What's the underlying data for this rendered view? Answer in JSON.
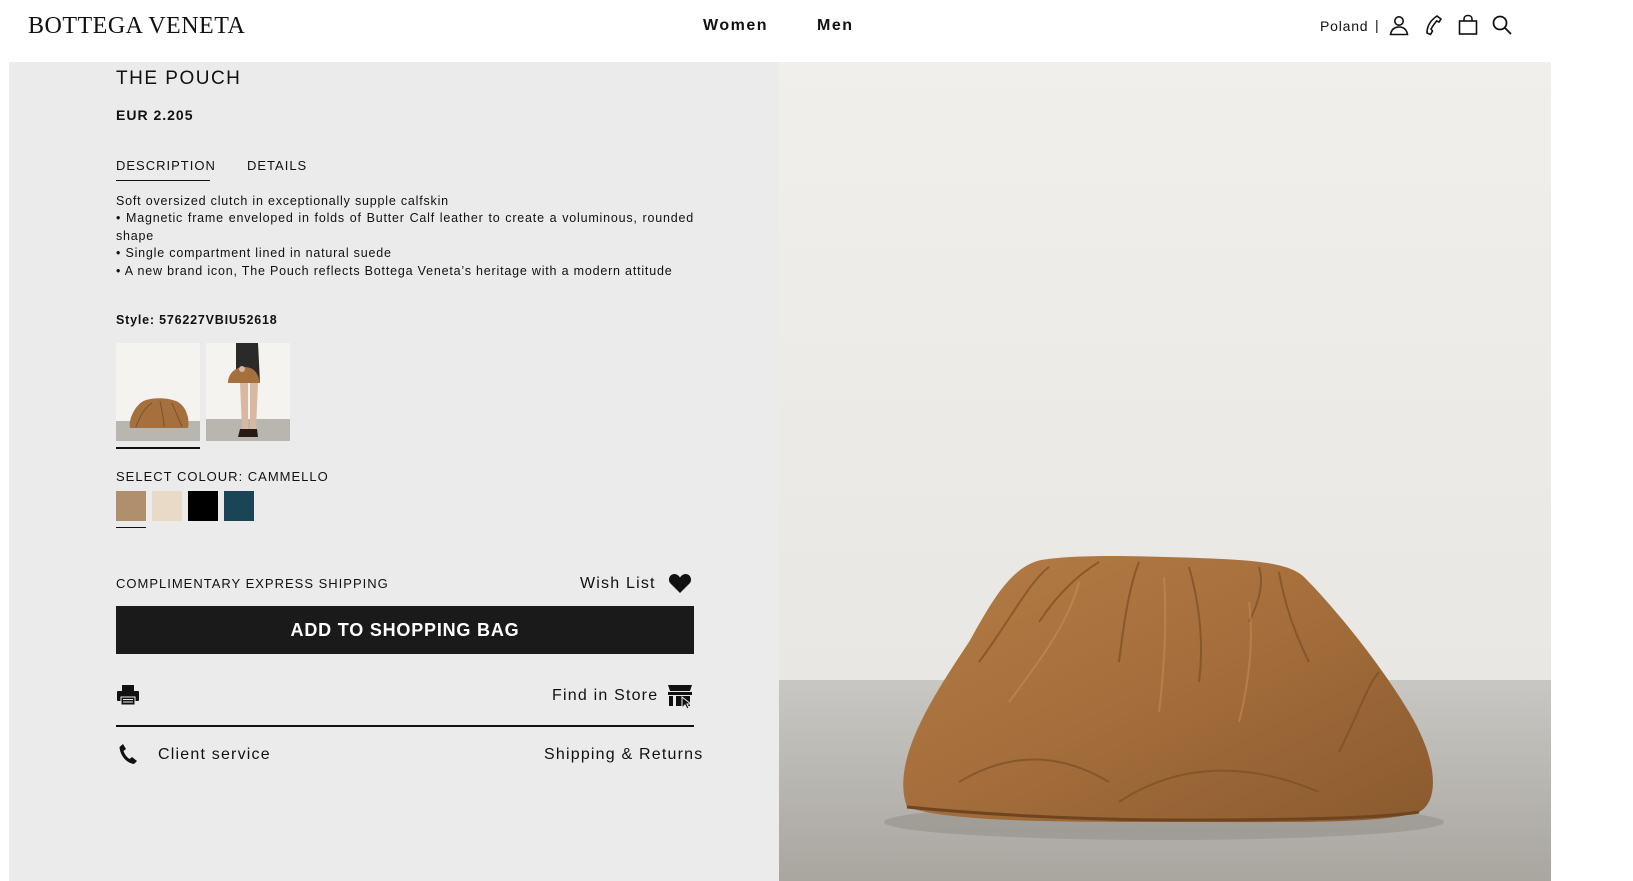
{
  "header": {
    "logo": "BOTTEGA VENETA",
    "nav": [
      "Women",
      "Men"
    ],
    "country": "Poland",
    "separator": "|",
    "icons": [
      "account-icon",
      "phone-icon",
      "shopping-bag-icon",
      "search-icon"
    ]
  },
  "product": {
    "title": "THE POUCH",
    "price": "EUR 2.205",
    "tabs": [
      "DESCRIPTION",
      "DETAILS"
    ],
    "active_tab": "DESCRIPTION",
    "description": [
      "Soft oversized clutch in exceptionally supple calfskin",
      "• Magnetic frame enveloped in folds of Butter Calf leather to create a voluminous, rounded shape",
      "• Single compartment lined in natural suede",
      "• A new brand icon, The Pouch reflects Bottega Veneta’s heritage with a modern attitude"
    ],
    "style": "Style: 576227VBIU52618",
    "colour_label": "SELECT COLOUR: CAMMELLO",
    "colours": [
      "#b08f6d",
      "#e8dac6",
      "#000000",
      "#194556"
    ],
    "selected_colour_index": 0
  },
  "actions": {
    "shipping": "COMPLIMENTARY EXPRESS SHIPPING",
    "wishlist": "Wish List",
    "add_to_bag": "ADD TO SHOPPING BAG",
    "find_in_store": "Find in Store",
    "client_service": "Client service",
    "shipping_returns": "Shipping & Returns"
  },
  "colors": {
    "accent": "#1a1a1a",
    "panel_bg": "#ebebeb",
    "bag": "#a87342"
  }
}
